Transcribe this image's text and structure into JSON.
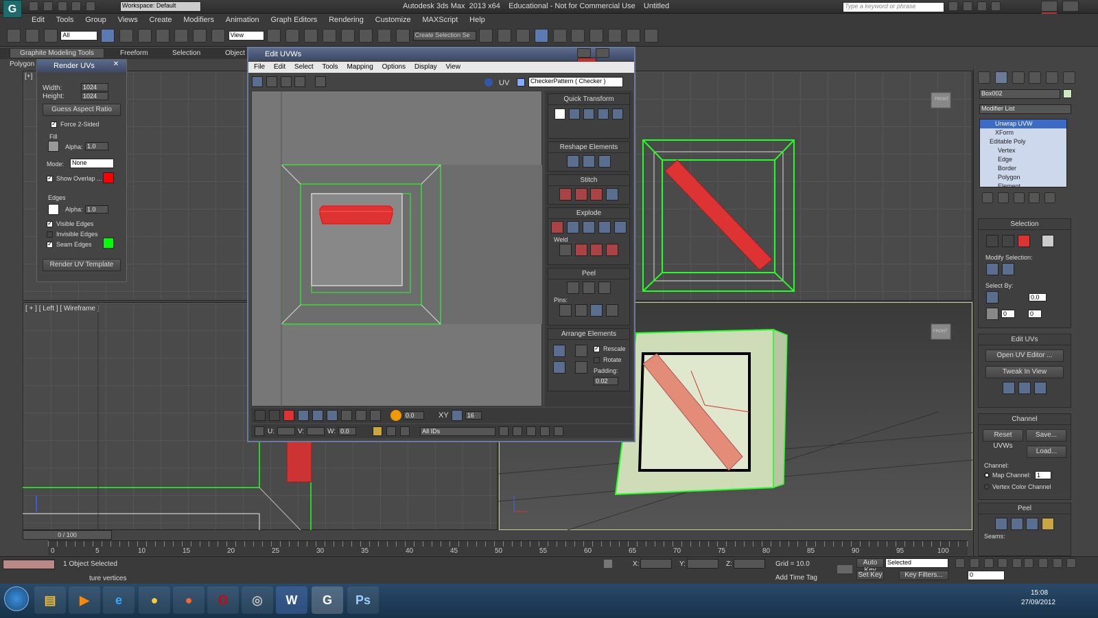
{
  "app": {
    "title": "Autodesk 3ds Max  2013 x64    Educational - Not for Commercial Use    Untitled",
    "workspace": "Workspace: Default",
    "search_placeholder": "Type a keyword or phrase"
  },
  "menu": [
    "Edit",
    "Tools",
    "Group",
    "Views",
    "Create",
    "Modifiers",
    "Animation",
    "Graph Editors",
    "Rendering",
    "Customize",
    "MAXScript",
    "Help"
  ],
  "toolbar": {
    "filter": "All",
    "refcoord": "View",
    "selection_set": "Create Selection Se"
  },
  "ribbon": {
    "tabs": [
      "Graphite Modeling Tools",
      "Freeform",
      "Selection",
      "Object P"
    ],
    "sub": "Polygon"
  },
  "render_uvs": {
    "title": "Render UVs",
    "width_label": "Width:",
    "width": "1024",
    "height_label": "Height:",
    "height": "1024",
    "guess_aspect": "Guess Aspect Ratio",
    "force_2sided": "Force 2-Sided",
    "fill_label": "Fill",
    "alpha_label": "Alpha:",
    "fill_alpha": "1.0",
    "mode_label": "Mode:",
    "mode": "None",
    "show_overlap": "Show Overlap ...",
    "edges_label": "Edges",
    "edges_alpha": "1.0",
    "visible_edges": "Visible Edges",
    "invisible_edges": "Invisible Edges",
    "seam_edges": "Seam Edges",
    "render_template": "Render UV Template"
  },
  "edit_uvws": {
    "title": "Edit UVWs",
    "menu": [
      "File",
      "Edit",
      "Select",
      "Tools",
      "Mapping",
      "Options",
      "Display",
      "View"
    ],
    "uv_label": "UV",
    "texture": "CheckerPattern  ( Checker )",
    "rollouts": {
      "quick_transform": "Quick Transform",
      "reshape": "Reshape Elements",
      "stitch": "Stitch",
      "explode": "Explode",
      "weld": "Weld",
      "peel": "Peel",
      "pins": "Pins:",
      "arrange": "Arrange Elements",
      "rescale": "Rescale",
      "rotate": "Rotate",
      "padding_label": "Padding:",
      "padding": "0.02"
    },
    "bottom": {
      "u": "U:",
      "v": "V:",
      "w": "W:",
      "w_val": "0.0",
      "angle": "0.0",
      "xy": "XY",
      "count": "16",
      "ids": "All IDs"
    }
  },
  "viewports": {
    "left_label": "[ + ] [ Left ] [ Wireframe ]",
    "front_cube": "FRONT"
  },
  "right_panel": {
    "object_name": "Box002",
    "modifier_list": "Modifier List",
    "stack": [
      "Unwrap UVW",
      "XForm",
      "Editable Poly",
      "Vertex",
      "Edge",
      "Border",
      "Polygon",
      "Element"
    ],
    "selection": "Selection",
    "modify_selection": "Modify Selection:",
    "select_by": "Select By:",
    "sel_val1": "0.0",
    "sel_val2": "0",
    "sel_val3": "0",
    "edit_uvs": "Edit UVs",
    "open_uv_editor": "Open UV Editor ...",
    "tweak_in_view": "Tweak In View",
    "channel": "Channel",
    "reset_uvws": "Reset UVWs",
    "save": "Save...",
    "load": "Load...",
    "channel_label": "Channel:",
    "map_channel": "Map Channel:",
    "map_channel_val": "1",
    "vertex_color_channel": "Vertex Color Channel",
    "peel": "Peel",
    "seams": "Seams:"
  },
  "timeline": {
    "frame": "0 / 100",
    "ticks": [
      "0",
      "5",
      "10",
      "15",
      "20",
      "25",
      "30",
      "35",
      "40",
      "45",
      "50",
      "55",
      "60",
      "65",
      "70",
      "75",
      "80",
      "85",
      "90",
      "95",
      "100"
    ]
  },
  "status": {
    "selected": "1 Object Selected",
    "prompt": "ture vertices",
    "x": "X:",
    "y": "Y:",
    "z": "Z:",
    "grid": "Grid = 10.0",
    "add_time_tag": "Add Time Tag",
    "auto_key": "Auto Key",
    "set_key": "Set Key",
    "selected_dd": "Selected",
    "key_filters": "Key Filters...",
    "frame_field": "0"
  },
  "taskbar": {
    "time": "15:08",
    "date": "27/09/2012"
  }
}
